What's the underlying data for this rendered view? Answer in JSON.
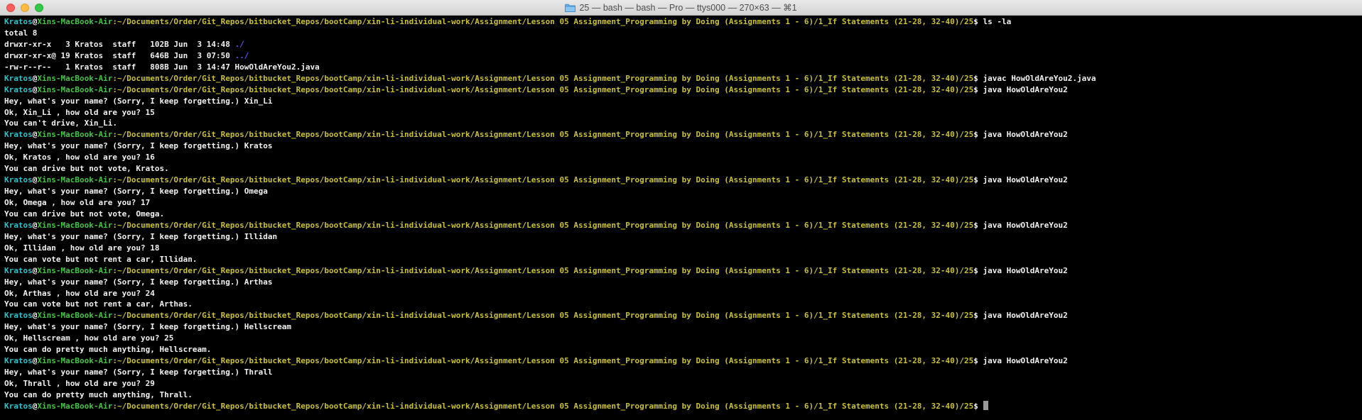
{
  "window": {
    "title": "25 — bash — bash — Pro — ttys000 — 270×63 — ⌘1",
    "folder_icon": "folder-icon"
  },
  "colors": {
    "user": "#2ac3cb",
    "host": "#45c445",
    "path": "#c8c036",
    "text": "#f2f2f2",
    "directory": "#5b5bf0",
    "background": "#000000"
  },
  "prompt": {
    "user": "Kratos",
    "at": "@",
    "host": "Xins-MacBook-Air",
    "path": ":~/Documents/Order/Git_Repos/bitbucket_Repos/bootCamp/xin-li-individual-work/Assignment/Lesson 05 Assignment_Programming by Doing (Assignments 1 - 6)/1_If Statements (21-28, 32-40)/25",
    "dollar": "$ "
  },
  "lines": [
    {
      "type": "prompt",
      "cmd": "ls -la"
    },
    {
      "type": "out",
      "text": "total 8"
    },
    {
      "type": "ls",
      "text": "drwxr-xr-x   3 Kratos  staff   102B Jun  3 14:48 ",
      "name": "./"
    },
    {
      "type": "ls",
      "text": "drwxr-xr-x@ 19 Kratos  staff   646B Jun  3 07:50 ",
      "name": "../"
    },
    {
      "type": "out",
      "text": "-rw-r--r--   1 Kratos  staff   808B Jun  3 14:47 HowOldAreYou2.java"
    },
    {
      "type": "prompt",
      "cmd": "javac HowOldAreYou2.java"
    },
    {
      "type": "prompt",
      "cmd": "java HowOldAreYou2"
    },
    {
      "type": "out",
      "text": "Hey, what's your name? (Sorry, I keep forgetting.) Xin_Li"
    },
    {
      "type": "out",
      "text": "Ok, Xin_Li , how old are you? 15"
    },
    {
      "type": "out",
      "text": "You can't drive, Xin_Li."
    },
    {
      "type": "prompt",
      "cmd": "java HowOldAreYou2"
    },
    {
      "type": "out",
      "text": "Hey, what's your name? (Sorry, I keep forgetting.) Kratos"
    },
    {
      "type": "out",
      "text": "Ok, Kratos , how old are you? 16"
    },
    {
      "type": "out",
      "text": "You can drive but not vote, Kratos."
    },
    {
      "type": "prompt",
      "cmd": "java HowOldAreYou2"
    },
    {
      "type": "out",
      "text": "Hey, what's your name? (Sorry, I keep forgetting.) Omega"
    },
    {
      "type": "out",
      "text": "Ok, Omega , how old are you? 17"
    },
    {
      "type": "out",
      "text": "You can drive but not vote, Omega."
    },
    {
      "type": "prompt",
      "cmd": "java HowOldAreYou2"
    },
    {
      "type": "out",
      "text": "Hey, what's your name? (Sorry, I keep forgetting.) Illidan"
    },
    {
      "type": "out",
      "text": "Ok, Illidan , how old are you? 18"
    },
    {
      "type": "out",
      "text": "You can vote but not rent a car, Illidan."
    },
    {
      "type": "prompt",
      "cmd": "java HowOldAreYou2"
    },
    {
      "type": "out",
      "text": "Hey, what's your name? (Sorry, I keep forgetting.) Arthas"
    },
    {
      "type": "out",
      "text": "Ok, Arthas , how old are you? 24"
    },
    {
      "type": "out",
      "text": "You can vote but not rent a car, Arthas."
    },
    {
      "type": "prompt",
      "cmd": "java HowOldAreYou2"
    },
    {
      "type": "out",
      "text": "Hey, what's your name? (Sorry, I keep forgetting.) Hellscream"
    },
    {
      "type": "out",
      "text": "Ok, Hellscream , how old are you? 25"
    },
    {
      "type": "out",
      "text": "You can do pretty much anything, Hellscream."
    },
    {
      "type": "prompt",
      "cmd": "java HowOldAreYou2"
    },
    {
      "type": "out",
      "text": "Hey, what's your name? (Sorry, I keep forgetting.) Thrall"
    },
    {
      "type": "out",
      "text": "Ok, Thrall , how old are you? 29"
    },
    {
      "type": "out",
      "text": "You can do pretty much anything, Thrall."
    },
    {
      "type": "prompt",
      "cmd": "",
      "cursor": true
    }
  ]
}
